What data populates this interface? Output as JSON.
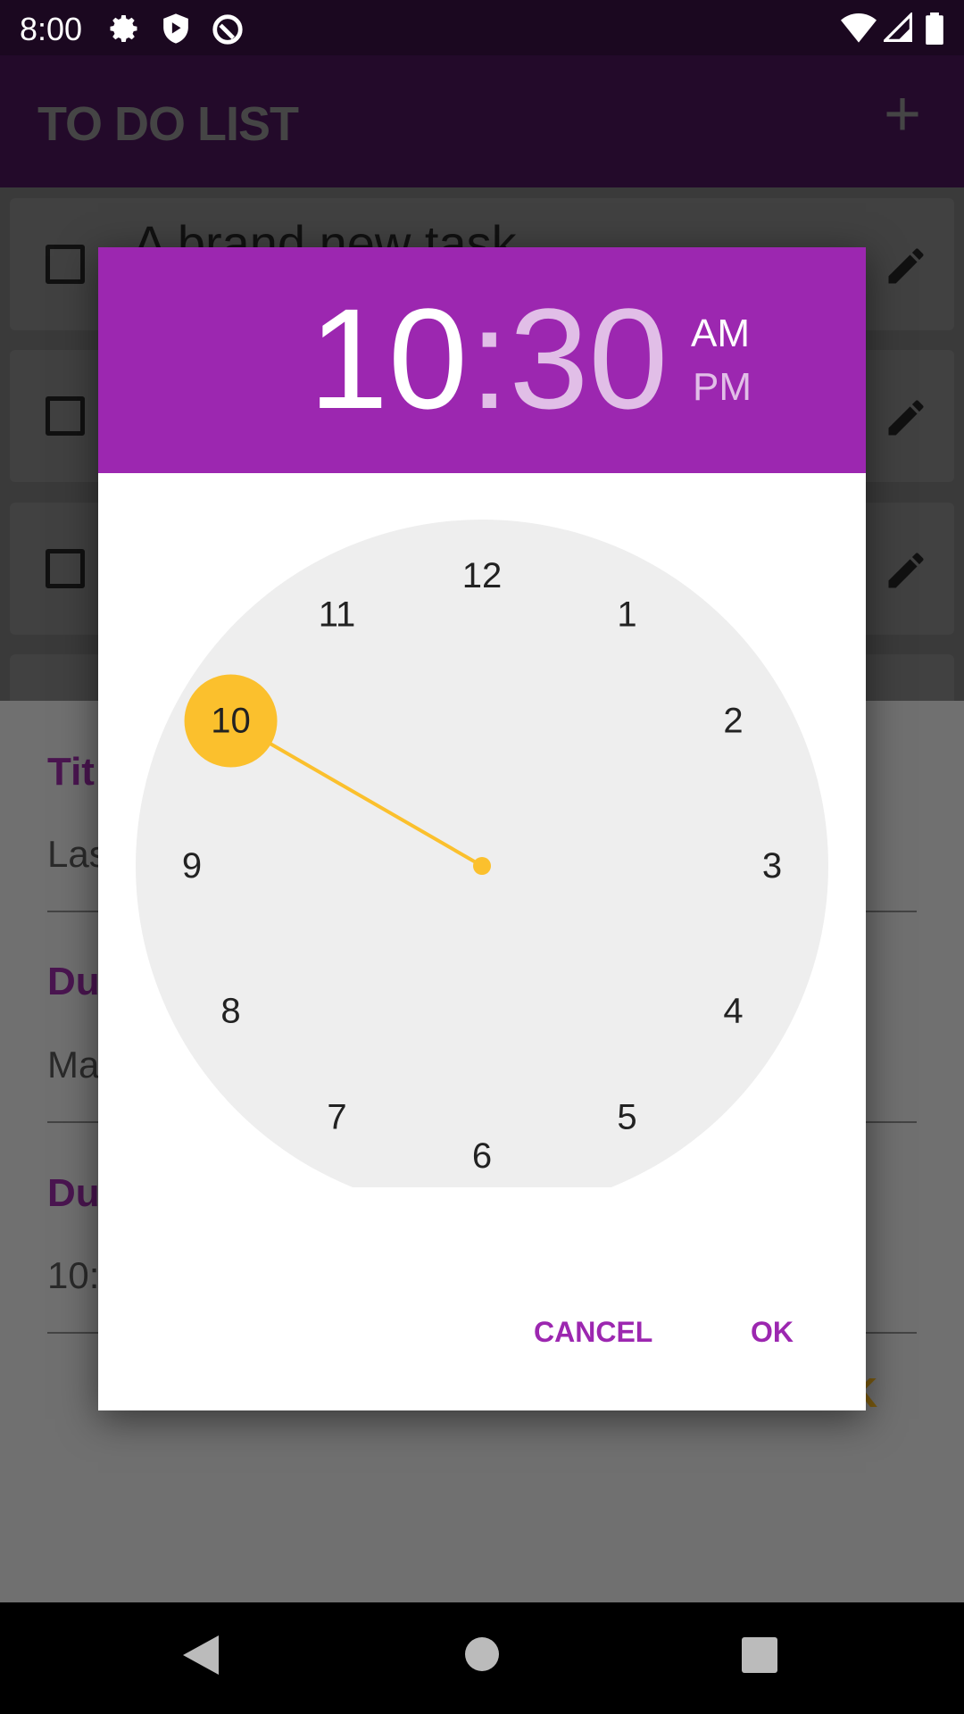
{
  "status_bar": {
    "time": "8:00",
    "icons": [
      "settings-icon",
      "play-protect-icon",
      "vpn-key-icon",
      "wifi-icon",
      "signal-icon",
      "battery-icon"
    ]
  },
  "app_bar": {
    "title": "TO DO LIST",
    "add_icon": "plus-icon"
  },
  "tasks": [
    {
      "title": "A brand new task"
    },
    {
      "title": ""
    },
    {
      "title": ""
    },
    {
      "title": ""
    }
  ],
  "form": {
    "title_label": "Tit",
    "title_value": "Las",
    "date_label": "Du",
    "date_value": "Ma",
    "time_label": "Du",
    "time_value": "10:",
    "ok_fragment": "K"
  },
  "time_picker": {
    "hour": "10",
    "minute": ":30",
    "am": "AM",
    "pm": "PM",
    "selected_period": "AM",
    "selected_hour": 10,
    "clock_numbers": [
      "12",
      "1",
      "2",
      "3",
      "4",
      "5",
      "6",
      "7",
      "8",
      "9",
      "10",
      "11"
    ],
    "cancel": "CANCEL",
    "ok": "OK"
  },
  "colors": {
    "accent": "#9c27b0",
    "accent_light": "#e1bee7",
    "selector": "#fbc02d",
    "clock_face": "#eeeeee"
  }
}
